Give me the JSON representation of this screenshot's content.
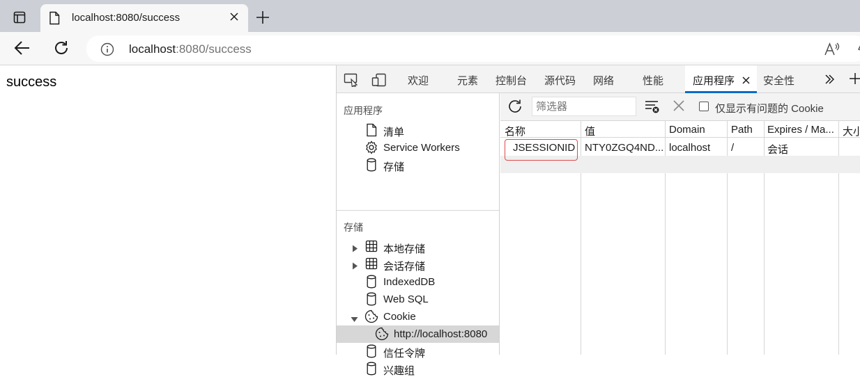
{
  "browser": {
    "tab_title": "localhost:8080/success",
    "url_host": "localhost",
    "url_rest": ":8080/success"
  },
  "page": {
    "text": "success"
  },
  "devtools": {
    "tabs": [
      "欢迎",
      "元素",
      "控制台",
      "源代码",
      "网络",
      "性能",
      "应用程序",
      "安全性"
    ],
    "active_tab": "应用程序",
    "sidebar": {
      "section_app": "应用程序",
      "app_items": [
        "清单",
        "Service Workers",
        "存储"
      ],
      "section_storage": "存储",
      "storage_items": [
        "本地存储",
        "会话存储",
        "IndexedDB",
        "Web SQL",
        "Cookie",
        "http://localhost:8080",
        "信任令牌",
        "兴趣组"
      ]
    },
    "cookies": {
      "filter_placeholder": "筛选器",
      "only_issues_label": "仅显示有问题的 Cookie",
      "columns": [
        "名称",
        "值",
        "Domain",
        "Path",
        "Expires / Ma...",
        "大小"
      ],
      "rows": [
        [
          "JSESSIONID",
          "NTY0ZGQ4ND...",
          "localhost",
          "/",
          "会话",
          ""
        ]
      ]
    }
  },
  "colors": {
    "accent": "#0b6bcb",
    "highlight": "#e04a4a"
  },
  "icons": [
    "tab-actions-icon",
    "page-icon",
    "close-icon",
    "plus-icon",
    "back-arrow-icon",
    "reload-icon",
    "info-icon",
    "read-aloud-icon",
    "favorite-icon",
    "inspect-icon",
    "device-icon",
    "more-tabs-icon",
    "document-icon",
    "gear-icon",
    "database-icon",
    "grid-icon",
    "cookie-icon",
    "refresh-icon",
    "clear-filter-icon"
  ]
}
